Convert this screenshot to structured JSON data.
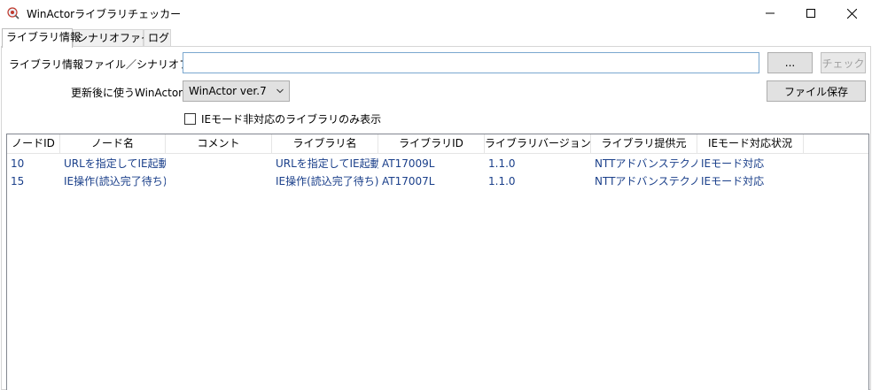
{
  "window": {
    "title": "WinActorライブラリチェッカー"
  },
  "tabs": [
    {
      "label": "ライブラリ情報"
    },
    {
      "label": "シナリオファイル"
    },
    {
      "label": "ログ"
    }
  ],
  "form": {
    "file_label": "ライブラリ情報ファイル／シナリオファイル",
    "file_value": "",
    "browse_label": "...",
    "check_label": "チェック",
    "version_label": "更新後に使うWinActor",
    "version_selected": "WinActor ver.7",
    "save_label": "ファイル保存",
    "ie_only_label": "IEモード非対応のライブラリのみ表示"
  },
  "table": {
    "columns": [
      "ノードID",
      "ノード名",
      "コメント",
      "ライブラリ名",
      "ライブラリID",
      "ライブラリバージョン",
      "ライブラリ提供元",
      "IEモード対応状況"
    ],
    "rows": [
      [
        "10",
        "URLを指定してIE起動",
        "",
        "URLを指定してIE起動",
        "AT17009L",
        "1.1.0",
        "NTTアドバンステクノロジ",
        "IEモード対応"
      ],
      [
        "15",
        "IE操作(読込完了待ち)",
        "",
        "IE操作(読込完了待ち)",
        "AT17007L",
        "1.1.0",
        "NTTアドバンステクノロジ",
        "IEモード対応"
      ]
    ]
  }
}
